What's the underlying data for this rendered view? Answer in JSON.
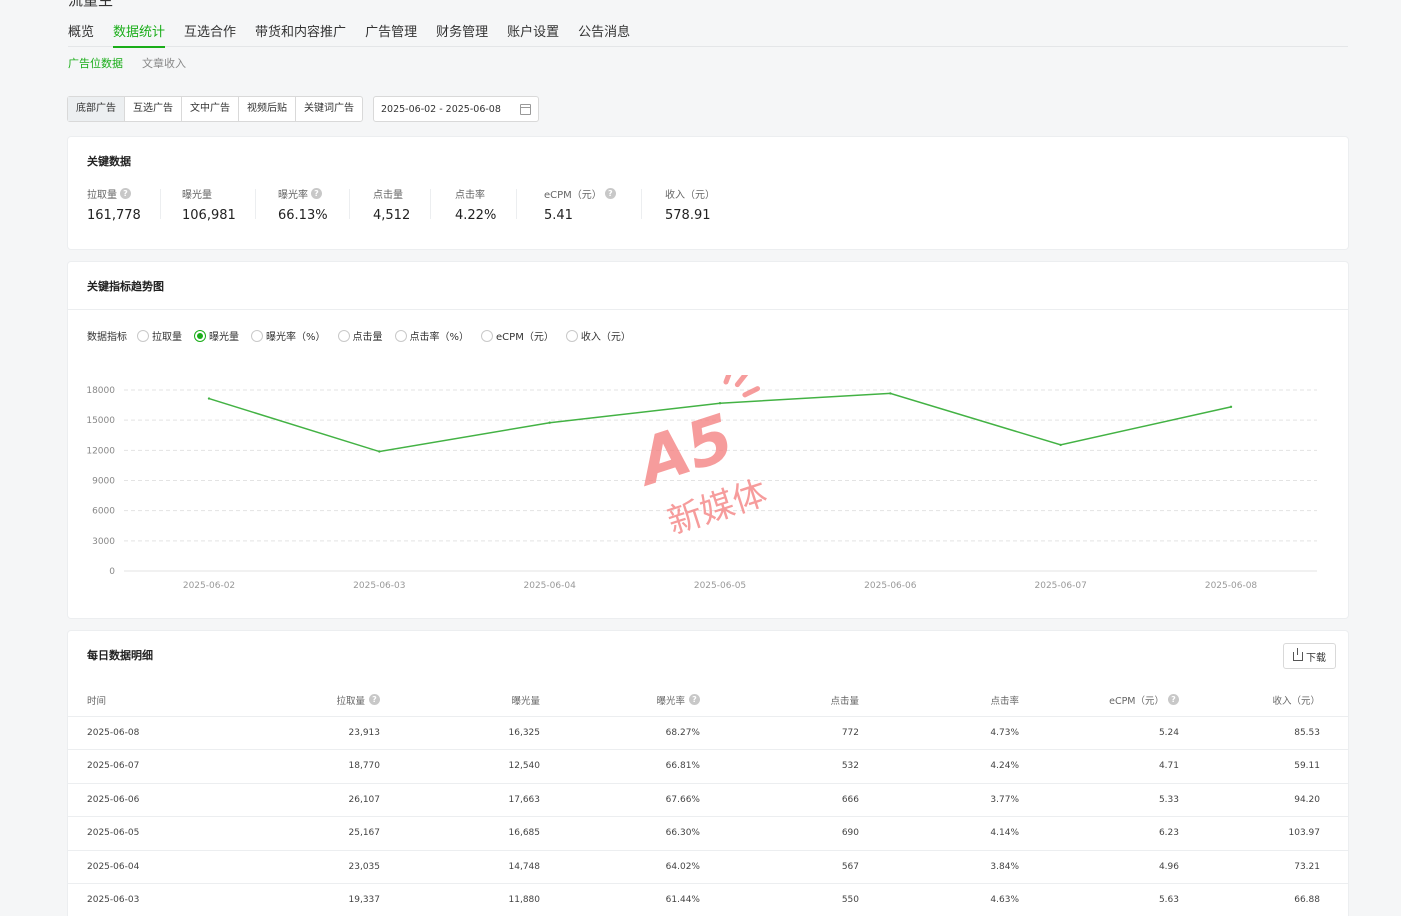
{
  "top_nav": [
    "概览",
    "数据统计",
    "互选合作",
    "带货和内容推广",
    "广告管理",
    "财务管理",
    "账户设置",
    "公告消息"
  ],
  "sub_nav": [
    "广告位数据",
    "文章收入"
  ],
  "ad_tabs": [
    "底部广告",
    "互选广告",
    "文中广告",
    "视频后贴",
    "关键词广告"
  ],
  "date_range": "2025-06-02 - 2025-06-08",
  "key_data": {
    "title": "关键数据",
    "metrics": [
      {
        "label": "拉取量",
        "value": "161,778",
        "help": true
      },
      {
        "label": "曝光量",
        "value": "106,981",
        "help": false
      },
      {
        "label": "曝光率",
        "value": "66.13%",
        "help": true
      },
      {
        "label": "点击量",
        "value": "4,512",
        "help": false
      },
      {
        "label": "点击率",
        "value": "4.22%",
        "help": false
      },
      {
        "label": "eCPM（元）",
        "value": "5.41",
        "help": true
      },
      {
        "label": "收入（元）",
        "value": "578.91",
        "help": false
      }
    ]
  },
  "trend": {
    "title": "关键指标趋势图",
    "indicator_label": "数据指标",
    "options": [
      "拉取量",
      "曝光量",
      "曝光率（%）",
      "点击量",
      "点击率（%）",
      "eCPM（元）",
      "收入（元）"
    ],
    "selected": "曝光量"
  },
  "chart_data": {
    "type": "line",
    "x": [
      "2025-06-02",
      "2025-06-03",
      "2025-06-04",
      "2025-06-05",
      "2025-06-06",
      "2025-06-07",
      "2025-06-08"
    ],
    "series": [
      {
        "values": [
          17150,
          11880,
          14748,
          16685,
          17663,
          12540,
          16325
        ]
      }
    ],
    "yticks": [
      "0",
      "3000",
      "6000",
      "9000",
      "12000",
      "15000",
      "18000"
    ],
    "ylim": [
      0,
      18000
    ],
    "grid": true,
    "color": "#43b244"
  },
  "daily": {
    "title": "每日数据明细",
    "download_label": "下载",
    "columns": [
      {
        "label": "时间",
        "help": false
      },
      {
        "label": "拉取量",
        "help": true
      },
      {
        "label": "曝光量",
        "help": false
      },
      {
        "label": "曝光率",
        "help": true
      },
      {
        "label": "点击量",
        "help": false
      },
      {
        "label": "点击率",
        "help": false
      },
      {
        "label": "eCPM（元）",
        "help": true
      },
      {
        "label": "收入（元）",
        "help": false
      }
    ],
    "rows": [
      [
        "2025-06-08",
        "23,913",
        "16,325",
        "68.27%",
        "772",
        "4.73%",
        "5.24",
        "85.53"
      ],
      [
        "2025-06-07",
        "18,770",
        "12,540",
        "66.81%",
        "532",
        "4.24%",
        "4.71",
        "59.11"
      ],
      [
        "2025-06-06",
        "26,107",
        "17,663",
        "67.66%",
        "666",
        "3.77%",
        "5.33",
        "94.20"
      ],
      [
        "2025-06-05",
        "25,167",
        "16,685",
        "66.30%",
        "690",
        "4.14%",
        "6.23",
        "103.97"
      ],
      [
        "2025-06-04",
        "23,035",
        "14,748",
        "64.02%",
        "567",
        "3.84%",
        "4.96",
        "73.21"
      ],
      [
        "2025-06-03",
        "19,337",
        "11,880",
        "61.44%",
        "550",
        "4.63%",
        "5.63",
        "66.88"
      ]
    ]
  },
  "watermark": {
    "logo": "A5",
    "text": "新媒体"
  },
  "colors": {
    "accent": "#1aad19",
    "line": "#43b244",
    "watermark": "#f26d6d"
  }
}
